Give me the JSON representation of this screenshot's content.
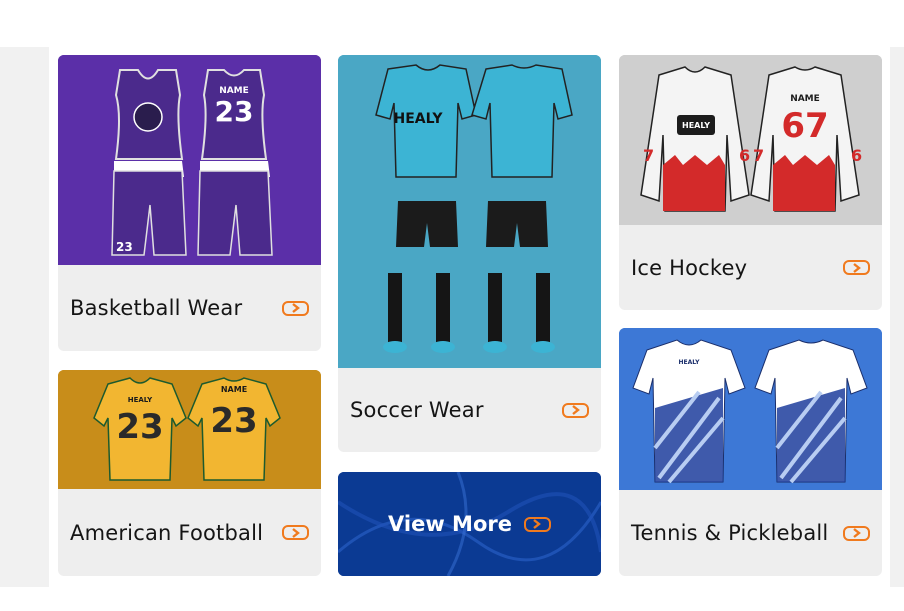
{
  "categories": {
    "basketball": {
      "label": "Basketball Wear",
      "jersey_name": "NAME",
      "jersey_number": "23",
      "shorts_number": "23",
      "arrow_icon": "arrow-right-icon"
    },
    "american_football": {
      "label": "American Football",
      "jersey_name": "NAME",
      "brand": "HEALY",
      "jersey_number": "23"
    },
    "soccer": {
      "label": "Soccer Wear",
      "brand": "HEALY"
    },
    "ice_hockey": {
      "label": "Ice Hockey",
      "jersey_name": "NAME",
      "jersey_number": "67",
      "sleeve_number": "7",
      "sleeve_number_right": "6",
      "brand": "HEALY"
    },
    "tennis": {
      "label": "Tennis & Pickleball",
      "brand": "HEALY"
    }
  },
  "view_more": {
    "label": "View More"
  },
  "colors": {
    "accent": "#f07a1e",
    "basketball_bg": "#5b2fa8",
    "football_bg": "#c88d1a",
    "soccer_bg": "#4aa7c5",
    "viewmore_bg": "#0b3a93",
    "hockey_bg": "#cfcfcf",
    "tennis_bg": "#3d78d6"
  }
}
